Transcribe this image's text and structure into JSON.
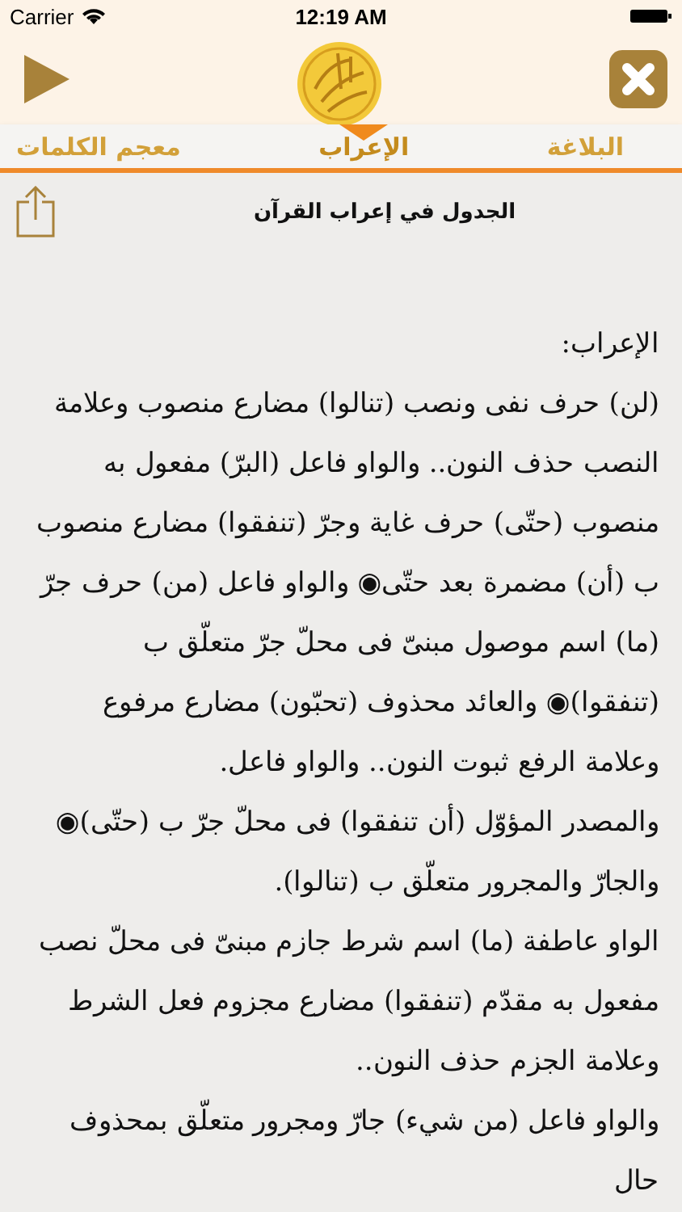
{
  "status_bar": {
    "carrier": "Carrier",
    "time": "12:19 AM"
  },
  "tabs": [
    {
      "label": "البلاغة",
      "selected": false
    },
    {
      "label": "الإعراب",
      "selected": true
    },
    {
      "label": "معجم الكلمات",
      "selected": false
    }
  ],
  "header": {
    "title": "الجدول في إعراب القرآن"
  },
  "paragraphs": [
    "الإعراب:",
    "(لن) حرف نفى ونصب (تنالوا) مضارع منصوب وعلامة النصب حذف النون.. والواو فاعل (البرّ) مفعول به منصوب (حتّى) حرف غاية وجرّ (تنفقوا) مضارع منصوب ب (أن) مضمرة بعد حتّى◉ والواو فاعل (من) حرف جرّ (ما) اسم موصول مبنىّ فى محلّ جرّ متعلّق ب (تنفقوا)◉ والعائد محذوف (تحبّون) مضارع مرفوع وعلامة الرفع ثبوت النون.. والواو فاعل.",
    "والمصدر المؤوّل (أن تنفقوا) فى محلّ جرّ ب (حتّى)◉ والجارّ والمجرور متعلّق ب (تنالوا).",
    "الواو عاطفة (ما) اسم شرط جازم مبنىّ فى محلّ نصب مفعول به مقدّم (تنفقوا) مضارع مجزوم فعل الشرط وعلامة الجزم حذف النون..",
    "والواو فاعل (من شيء) جارّ ومجرور متعلّق بمحذوف حال"
  ]
}
